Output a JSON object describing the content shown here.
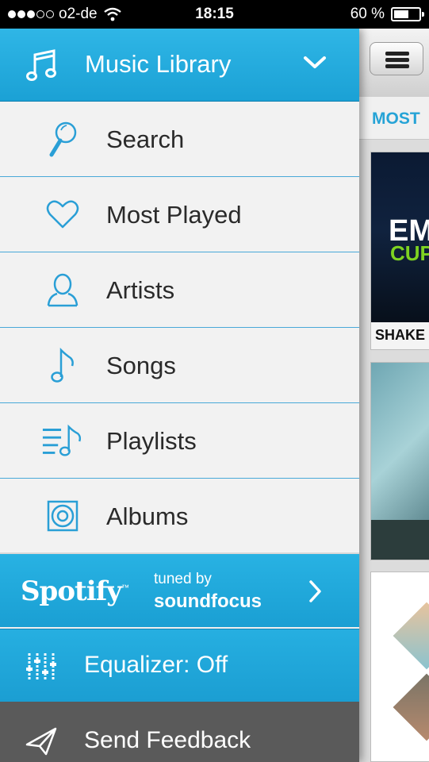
{
  "status_bar": {
    "carrier": "o2-de",
    "time": "18:15",
    "battery_text": "60 %",
    "battery_level": 0.6,
    "signal_filled": 3,
    "signal_total": 5,
    "icons": [
      "signal-dots-icon",
      "wifi-icon",
      "battery-icon"
    ]
  },
  "menu": {
    "header": {
      "title": "Music Library",
      "icon": "music-notes-icon",
      "chevron": "chevron-down-icon"
    },
    "items": [
      {
        "label": "Search",
        "icon": "search-icon"
      },
      {
        "label": "Most Played",
        "icon": "heart-icon"
      },
      {
        "label": "Artists",
        "icon": "person-icon"
      },
      {
        "label": "Songs",
        "icon": "music-note-icon"
      },
      {
        "label": "Playlists",
        "icon": "playlist-icon"
      },
      {
        "label": "Albums",
        "icon": "album-icon"
      }
    ],
    "spotify": {
      "logo_text": "Spotify",
      "tm": "™",
      "tuned_by": "tuned by",
      "brand": "soundfocus",
      "chevron": "chevron-right-icon"
    },
    "equalizer": {
      "label": "Equalizer: Off",
      "icon": "equalizer-icon"
    },
    "feedback": {
      "label": "Send Feedback",
      "icon": "paper-plane-icon"
    }
  },
  "background_app": {
    "tab_label": "MOST",
    "card1_line1": "EM",
    "card1_line2": "CUP",
    "card1_caption": "SHAKE"
  },
  "colors": {
    "accent": "#1ba1d5",
    "menu_bg": "#f2f2f2",
    "divider": "#49a9d8",
    "feedback_bg": "#5a5a5a",
    "icon_blue": "#2a9fd6"
  }
}
